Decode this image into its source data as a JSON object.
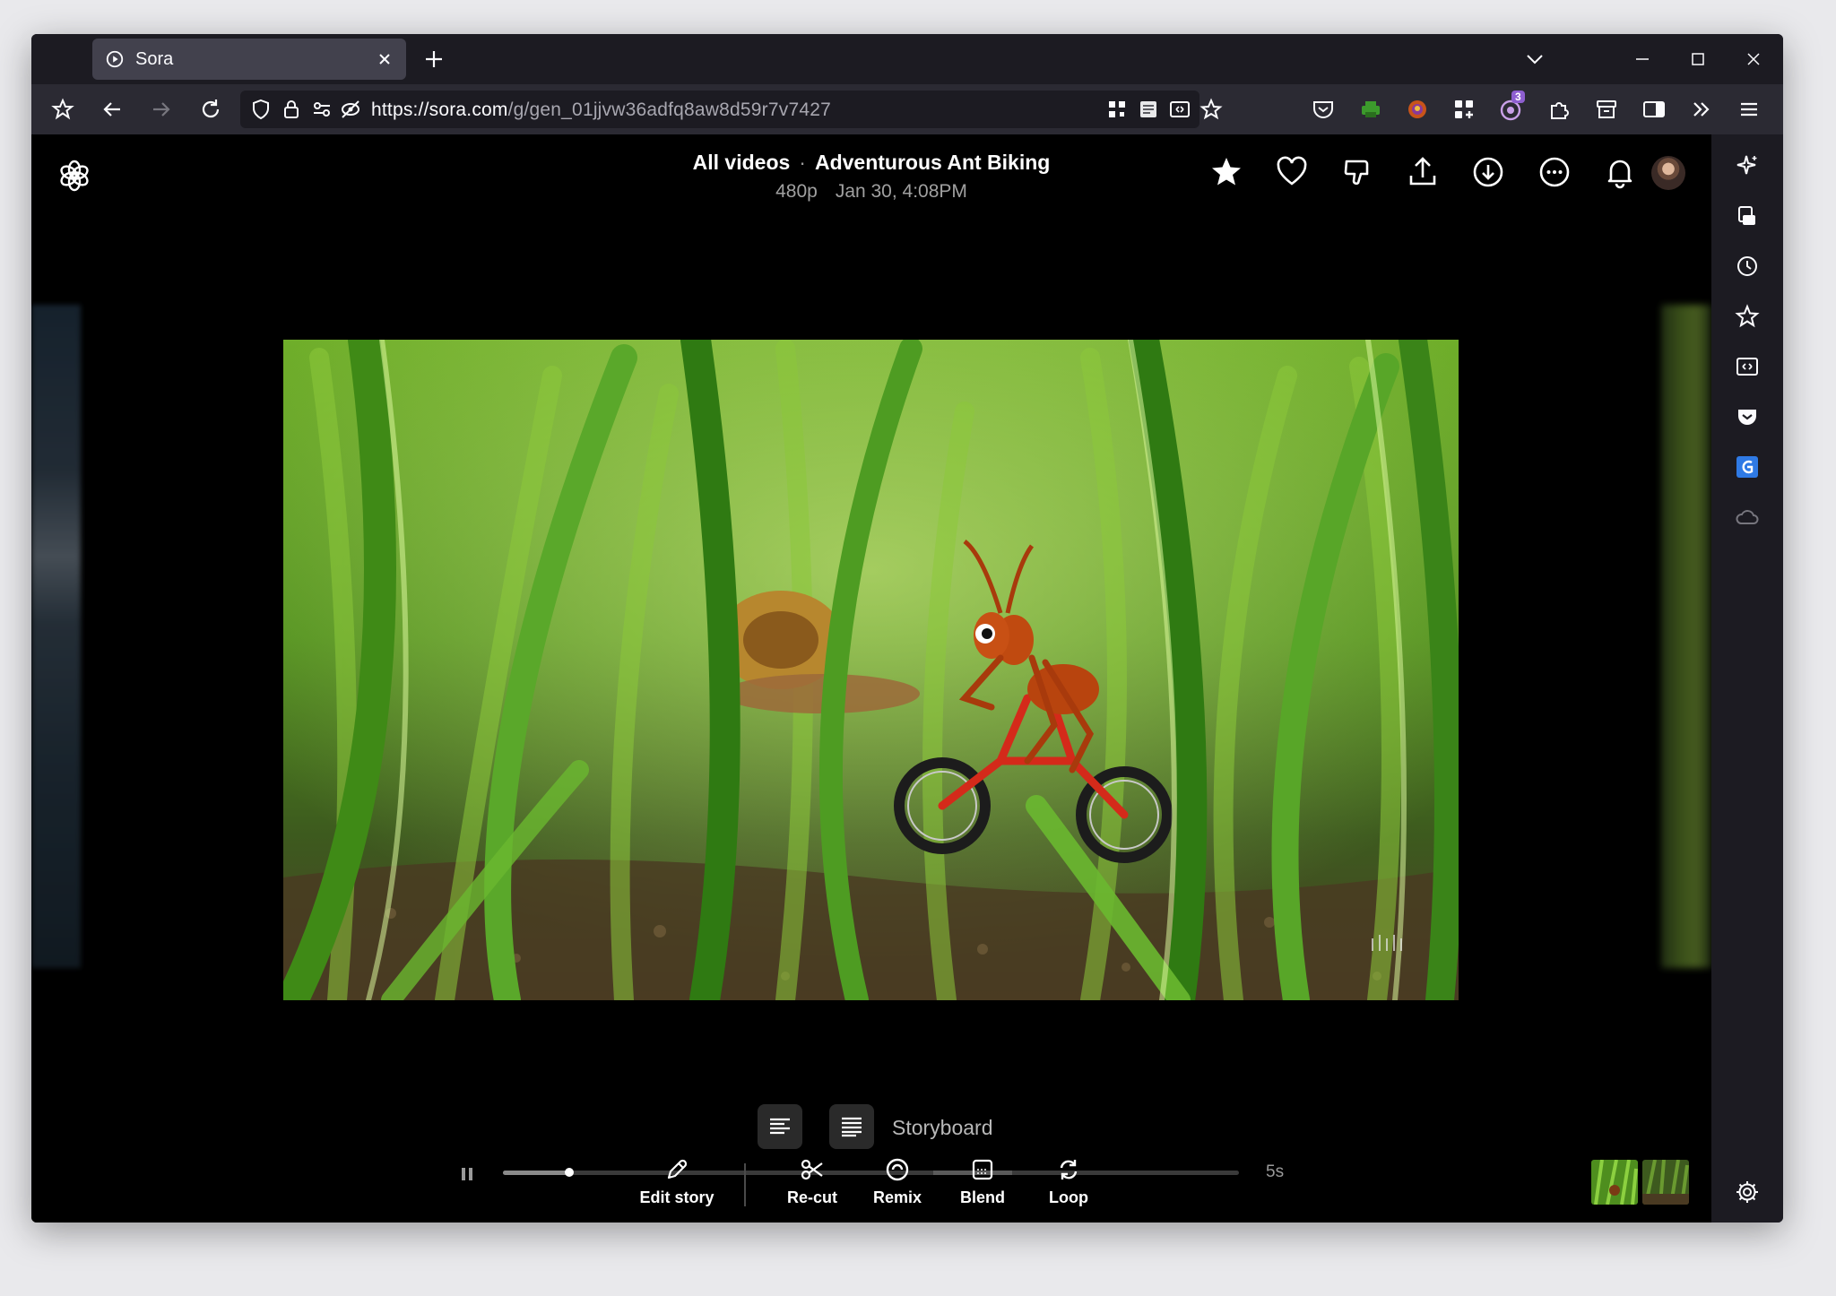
{
  "browser": {
    "tab_title": "Sora",
    "url_host": "https://sora.com",
    "url_path": "/g/gen_01jjvw36adfq8aw8d59r7v7427",
    "extension_badge": "3"
  },
  "header": {
    "breadcrumb_parent": "All videos",
    "breadcrumb_separator": "·",
    "title": "Adventurous Ant Biking",
    "resolution": "480p",
    "timestamp": "Jan 30, 4:08PM"
  },
  "player": {
    "mode_label": "Storyboard",
    "duration": "5s",
    "progress_fraction": 0.09
  },
  "actions": [
    {
      "label": "Edit story",
      "icon": "pencil-icon"
    },
    {
      "label": "Re-cut",
      "icon": "scissors-icon"
    },
    {
      "label": "Remix",
      "icon": "remix-icon"
    },
    {
      "label": "Blend",
      "icon": "blend-icon"
    },
    {
      "label": "Loop",
      "icon": "loop-icon"
    }
  ],
  "colors": {
    "background": "#000000",
    "browser_chrome": "#2b2a33",
    "tab_active": "#42414d",
    "accent_green": "#3c8a1c"
  }
}
